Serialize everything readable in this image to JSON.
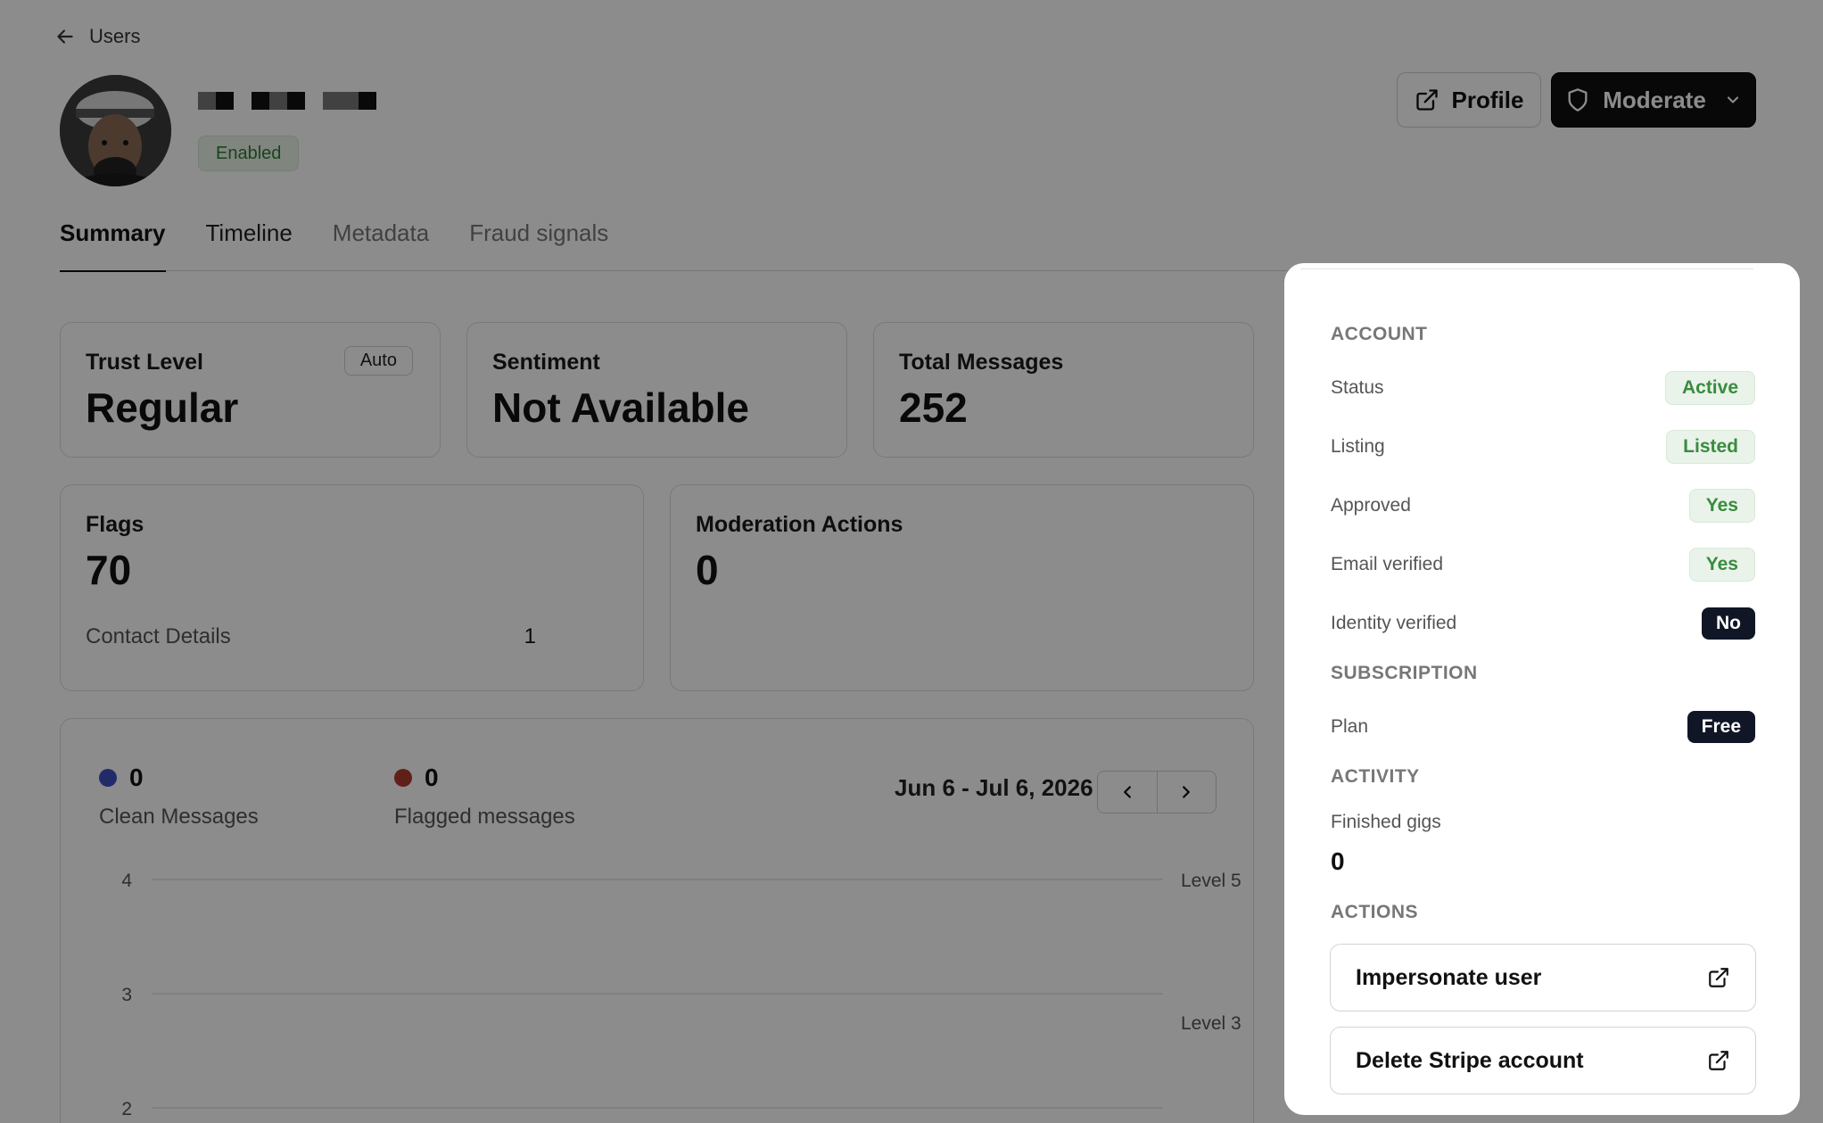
{
  "nav": {
    "back_label": "Users"
  },
  "user": {
    "status": "Enabled"
  },
  "header_actions": {
    "profile_label": "Profile",
    "moderate_label": "Moderate"
  },
  "tabs": [
    {
      "label": "Summary"
    },
    {
      "label": "Timeline"
    },
    {
      "label": "Metadata"
    },
    {
      "label": "Fraud signals"
    }
  ],
  "stats": {
    "trust": {
      "label": "Trust Level",
      "badge": "Auto",
      "value": "Regular"
    },
    "sentiment": {
      "label": "Sentiment",
      "value": "Not Available"
    },
    "messages": {
      "label": "Total Messages",
      "value": "252"
    },
    "flags": {
      "label": "Flags",
      "value": "70",
      "detail_label": "Contact Details",
      "detail_value": "1"
    },
    "moderation": {
      "label": "Moderation Actions",
      "value": "0"
    }
  },
  "activity_chart": {
    "clean": {
      "count": "0",
      "label": "Clean Messages",
      "color": "#3f4fc2"
    },
    "flagged": {
      "count": "0",
      "label": "Flagged messages",
      "color": "#b0392b"
    },
    "date_range": "Jun 6 - Jul 6, 2026"
  },
  "chart_data": {
    "type": "line",
    "series": [
      {
        "name": "Clean Messages",
        "values": []
      },
      {
        "name": "Flagged messages",
        "values": []
      }
    ],
    "y_ticks": [
      "4",
      "3",
      "2"
    ],
    "ylim": [
      2,
      4
    ],
    "right_labels": [
      {
        "text": "Level 5",
        "y": 4
      },
      {
        "text": "Level 3",
        "y": 2.75
      }
    ],
    "grid": true
  },
  "moderate_menu": {
    "account": {
      "heading": "ACCOUNT",
      "rows": [
        {
          "key": "Status",
          "value": "Active"
        },
        {
          "key": "Listing",
          "value": "Listed"
        },
        {
          "key": "Approved",
          "value": "Yes"
        },
        {
          "key": "Email verified",
          "value": "Yes"
        },
        {
          "key": "Identity verified",
          "value": "No"
        }
      ]
    },
    "subscription": {
      "heading": "SUBSCRIPTION",
      "plan_key": "Plan",
      "plan_value": "Free"
    },
    "activity": {
      "heading": "ACTIVITY",
      "gigs_label": "Finished gigs",
      "gigs_value": "0"
    },
    "actions": {
      "heading": "ACTIONS",
      "impersonate": "Impersonate user",
      "delete_stripe": "Delete Stripe account"
    }
  }
}
